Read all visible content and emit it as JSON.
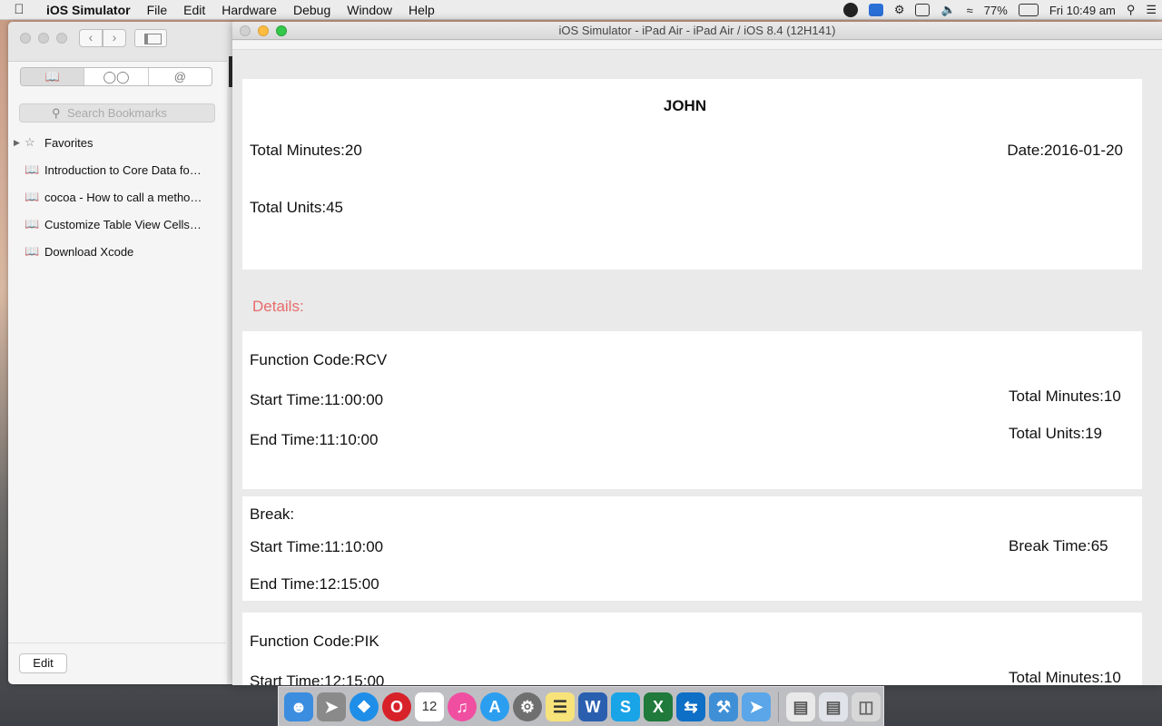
{
  "menubar": {
    "apple_icon": "apple-icon",
    "items": [
      "iOS Simulator",
      "File",
      "Edit",
      "Hardware",
      "Debug",
      "Window",
      "Help"
    ],
    "status": {
      "battery": "77%",
      "clock": "Fri 10:49 am"
    }
  },
  "sidebar": {
    "search_placeholder": "Search Bookmarks",
    "tabs": [
      "bookmarks-icon",
      "reading-list-icon",
      "@"
    ],
    "favorites_label": "Favorites",
    "bookmarks": [
      "Introduction to Core Data fo…",
      "cocoa - How to call a metho…",
      "Customize Table View Cells…",
      "Download Xcode"
    ],
    "edit_label": "Edit"
  },
  "simulator": {
    "title": "iOS Simulator - iPad Air - iPad Air / iOS 8.4 (12H141)",
    "summary": {
      "name": "JOHN",
      "total_minutes": "Total Minutes:20",
      "date": "Date:2016-01-20",
      "total_units": "Total Units:45"
    },
    "details_label": "Details:",
    "entries": [
      {
        "function_code": "Function Code:RCV",
        "start_time": "Start Time:11:00:00",
        "end_time": "End Time:11:10:00",
        "total_minutes": "Total Minutes:10",
        "total_units": "Total Units:19"
      },
      {
        "title": "Break:",
        "start_time": "Start Time:11:10:00",
        "end_time": "End Time:12:15:00",
        "break_time": "Break Time:65"
      },
      {
        "function_code": "Function Code:PIK",
        "start_time": "Start Time:12:15:00",
        "total_minutes": "Total Minutes:10"
      }
    ]
  },
  "dock": {
    "apps": [
      "Finder",
      "Launchpad",
      "Safari",
      "Opera",
      "Calendar",
      "iTunes",
      "App Store",
      "System Preferences",
      "Notes",
      "Word",
      "Skype",
      "Excel",
      "TeamViewer",
      "Xcode",
      "Instruments",
      "Documents",
      "Downloads",
      "Trash"
    ],
    "calendar_date": "12"
  }
}
